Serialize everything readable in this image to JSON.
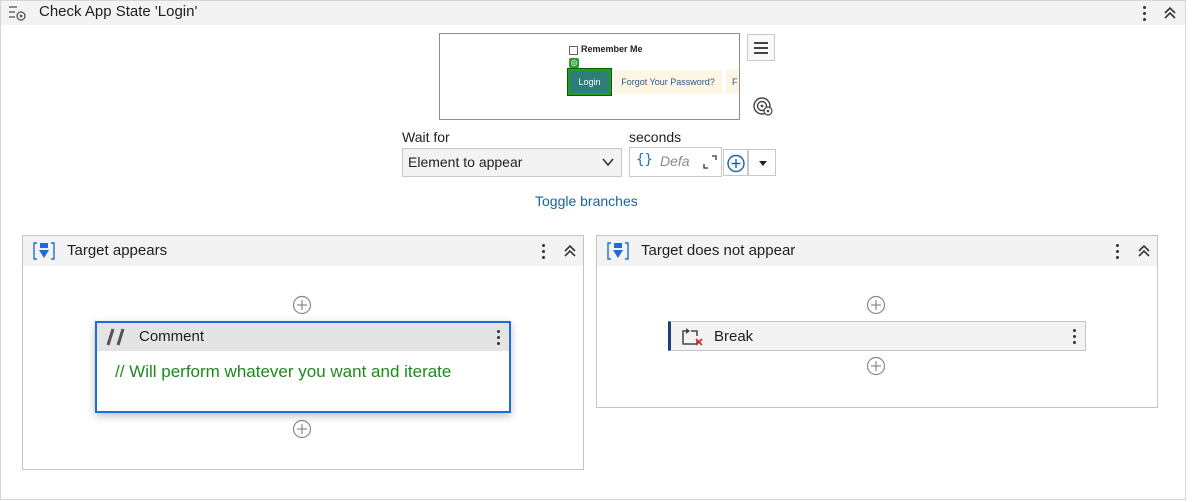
{
  "activity": {
    "title": "Check App State 'Login'"
  },
  "preview": {
    "remember_label": "Remember Me",
    "login_label": "Login",
    "forgot_label": "Forgot Your Password?",
    "cut_label": "F"
  },
  "wait": {
    "wait_for_label": "Wait for",
    "selected_option": "Element to appear",
    "seconds_label": "seconds",
    "seconds_placeholder": "Defa",
    "expression_symbol": "{}"
  },
  "toggle_link": "Toggle branches",
  "branches": {
    "appears": {
      "title": "Target appears",
      "comment": {
        "title": "Comment",
        "text": "// Will perform whatever you want and iterate"
      }
    },
    "not_appears": {
      "title": "Target does not appear",
      "break": {
        "title": "Break"
      }
    }
  },
  "colors": {
    "accent": "#1a6fd6",
    "link": "#1565a0",
    "comment_text": "#1b8a1b",
    "header_bg": "#f3f3f3"
  },
  "icons": {
    "header": "check-state-icon",
    "menu": "menu-icon",
    "target": "target-icon",
    "branch": "sequence-icon",
    "comment": "comment-icon",
    "break": "break-icon",
    "add": "add-circle-icon"
  }
}
